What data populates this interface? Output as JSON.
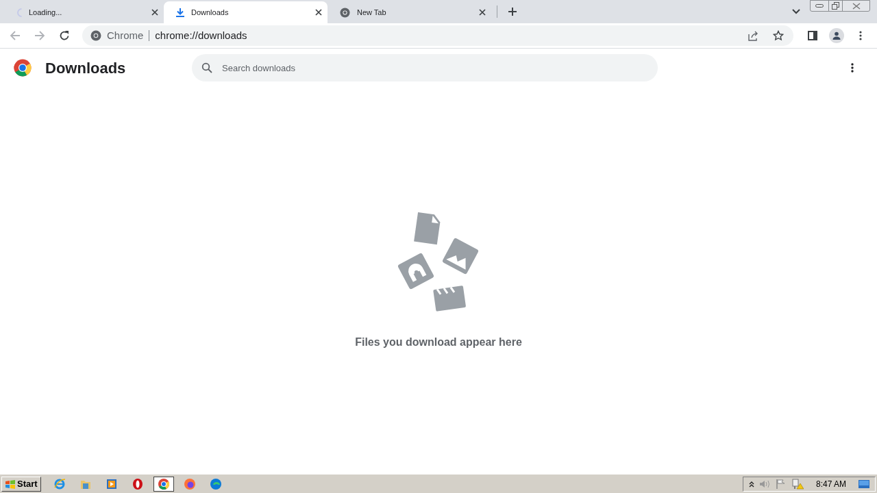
{
  "tabs": [
    {
      "label": "Loading...",
      "kind": "loading",
      "selected": false
    },
    {
      "label": "Downloads",
      "kind": "download",
      "selected": true
    },
    {
      "label": "New Tab",
      "kind": "chrome",
      "selected": false
    }
  ],
  "address": {
    "origin": "Chrome",
    "url": "chrome://downloads"
  },
  "page": {
    "title": "Downloads",
    "search": {
      "placeholder": "Search downloads"
    },
    "empty_message": "Files you download appear here"
  },
  "taskbar": {
    "start": "Start",
    "apps": [
      {
        "kind": "ie",
        "selected": false
      },
      {
        "kind": "folder",
        "selected": false
      },
      {
        "kind": "media",
        "selected": false
      },
      {
        "kind": "opera",
        "selected": false
      },
      {
        "kind": "chrome",
        "selected": true
      },
      {
        "kind": "firefox",
        "selected": false
      },
      {
        "kind": "edge",
        "selected": false
      }
    ],
    "clock": "8:47 AM"
  }
}
